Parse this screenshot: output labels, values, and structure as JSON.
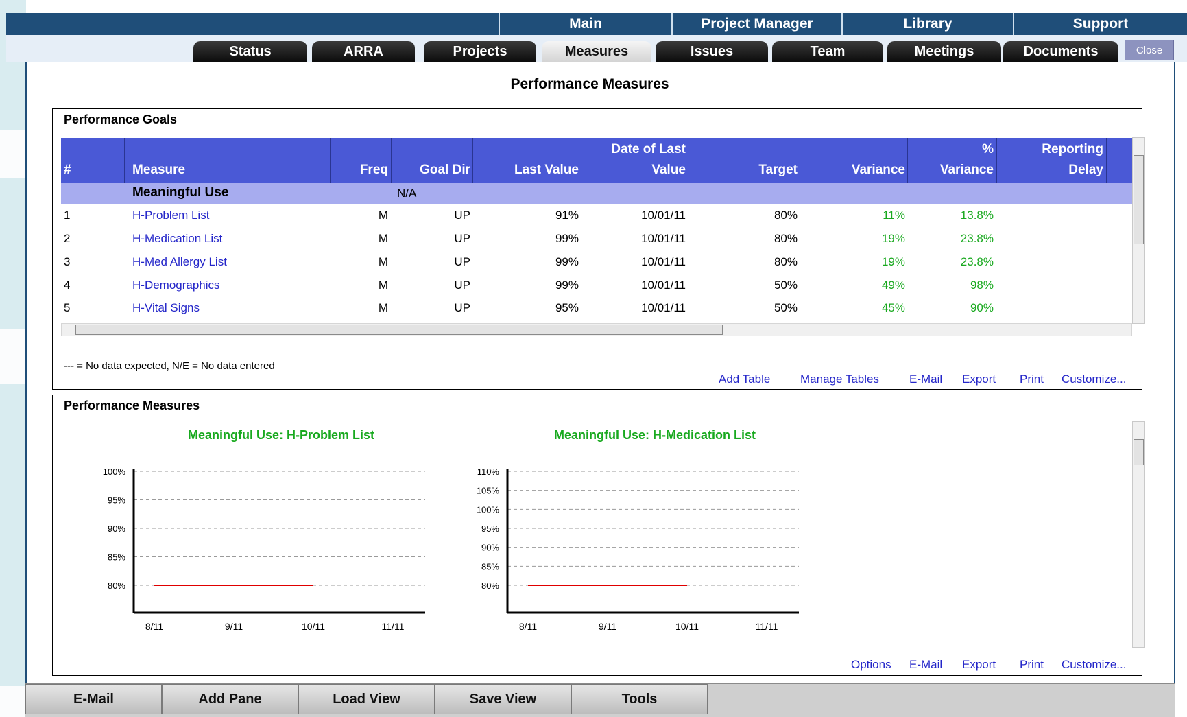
{
  "top_nav": [
    "Main",
    "Project Manager",
    "Library",
    "Support"
  ],
  "tabs": [
    "Status",
    "ARRA",
    "Projects",
    "Measures",
    "Issues",
    "Team",
    "Meetings",
    "Documents"
  ],
  "active_tab": "Measures",
  "close_label": "Close",
  "page_title": "Performance Measures",
  "goals_panel": {
    "title": "Performance Goals",
    "headers": {
      "num": "#",
      "measure": "Measure",
      "freq": "Freq",
      "goal_dir": "Goal Dir",
      "last_value": "Last Value",
      "date_line1": "Date of Last",
      "date_line2": "Value",
      "target": "Target",
      "variance": "Variance",
      "pct_line1": "%",
      "pct_line2": "Variance",
      "delay_line1": "Reporting",
      "delay_line2": "Delay"
    },
    "group": {
      "name": "Meaningful Use",
      "goal_dir": "N/A"
    },
    "rows": [
      {
        "num": "1",
        "measure": "H-Problem List",
        "freq": "M",
        "goal_dir": "UP",
        "last_value": "91%",
        "date": "10/01/11",
        "target": "80%",
        "variance": "11%",
        "pct_variance": "13.8%"
      },
      {
        "num": "2",
        "measure": "H-Medication List",
        "freq": "M",
        "goal_dir": "UP",
        "last_value": "99%",
        "date": "10/01/11",
        "target": "80%",
        "variance": "19%",
        "pct_variance": "23.8%"
      },
      {
        "num": "3",
        "measure": "H-Med Allergy List",
        "freq": "M",
        "goal_dir": "UP",
        "last_value": "99%",
        "date": "10/01/11",
        "target": "80%",
        "variance": "19%",
        "pct_variance": "23.8%"
      },
      {
        "num": "4",
        "measure": "H-Demographics",
        "freq": "M",
        "goal_dir": "UP",
        "last_value": "99%",
        "date": "10/01/11",
        "target": "50%",
        "variance": "49%",
        "pct_variance": "98%"
      },
      {
        "num": "5",
        "measure": "H-Vital Signs",
        "freq": "M",
        "goal_dir": "UP",
        "last_value": "95%",
        "date": "10/01/11",
        "target": "50%",
        "variance": "45%",
        "pct_variance": "90%"
      }
    ],
    "legend_note": "--- = No data expected, N/E = No data entered",
    "actions": [
      "Add Table",
      "Manage Tables",
      "E-Mail",
      "Export",
      "Print",
      "Customize..."
    ]
  },
  "measures_panel": {
    "title": "Performance Measures",
    "actions": [
      "Options",
      "E-Mail",
      "Export",
      "Print",
      "Customize..."
    ]
  },
  "chart_data": [
    {
      "type": "line",
      "title": "Meaningful Use: H-Problem List",
      "x": [
        "8/11",
        "9/11",
        "10/11",
        "11/11"
      ],
      "y_ticks": [
        "100%",
        "95%",
        "90%",
        "85%",
        "80%"
      ],
      "ylim": [
        80,
        100
      ],
      "grid": true,
      "series": [
        {
          "values": [
            80,
            80,
            80
          ],
          "color": "#e00000"
        }
      ]
    },
    {
      "type": "line",
      "title": "Meaningful Use: H-Medication List",
      "x": [
        "8/11",
        "9/11",
        "10/11",
        "11/11"
      ],
      "y_ticks": [
        "110%",
        "105%",
        "100%",
        "95%",
        "90%",
        "85%",
        "80%"
      ],
      "ylim": [
        80,
        110
      ],
      "grid": true,
      "series": [
        {
          "values": [
            80,
            80,
            80
          ],
          "color": "#e00000"
        }
      ]
    }
  ],
  "bottom_buttons": [
    "E-Mail",
    "Add Pane",
    "Load View",
    "Save View",
    "Tools"
  ],
  "colors": {
    "nav": "#1f4e79",
    "header": "#4a59d6",
    "group_row": "#a7acef",
    "link": "#2426c9",
    "positive": "#19a91f",
    "series": "#e00000"
  }
}
